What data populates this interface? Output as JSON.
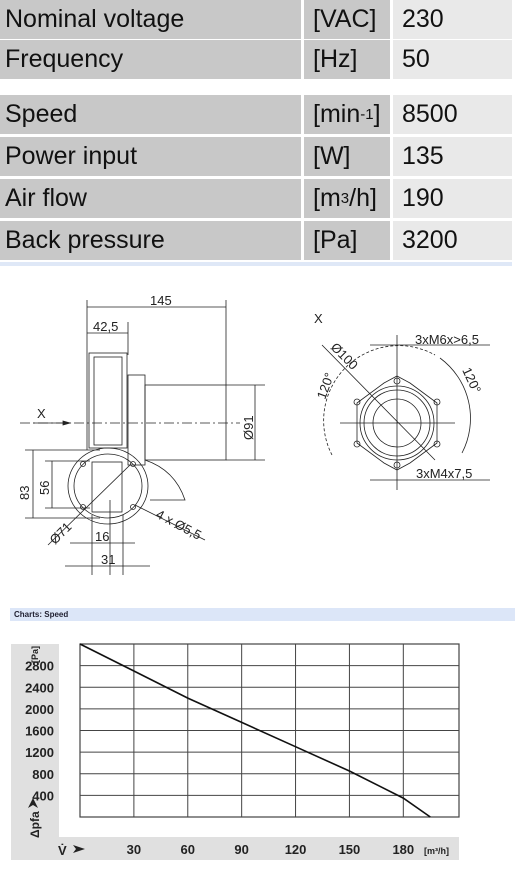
{
  "specs": [
    {
      "label": "Nominal voltage",
      "unit": "[VAC]",
      "value": "230"
    },
    {
      "label": "Frequency",
      "unit": "[Hz]",
      "value": "50"
    },
    {
      "label": "Speed",
      "unit": "[min-1]",
      "unit_base": "[min",
      "unit_sup": "-1",
      "unit_end": "]",
      "value": "8500"
    },
    {
      "label": "Power input",
      "unit": "[W]",
      "value": "135"
    },
    {
      "label": "Air flow",
      "unit": "[m3/h]",
      "unit_base": "[m",
      "unit_sup": "3",
      "unit_end": "/h]",
      "value": "190"
    },
    {
      "label": "Back pressure",
      "unit": "[Pa]",
      "value": "3200"
    }
  ],
  "drawing": {
    "dim_145": "145",
    "dim_42_5": "42,5",
    "axis_x": "X",
    "dim_91": "Ø91",
    "dim_83": "83",
    "dim_56": "56",
    "dim_71": "Ø71",
    "dim_16": "16",
    "dim_31": "31",
    "holes": "4 x Ø5,5",
    "view_x": "X",
    "dim_100": "Ø100",
    "thread_m6": "3xM6x>6,5",
    "thread_m4": "3xM4x7,5",
    "angle_left": "120°",
    "angle_right": "120°"
  },
  "chart_title": "Charts: Speed",
  "chart_data": {
    "type": "line",
    "ylabel": "Δpfa",
    "yunit": "[Pa]",
    "xlabel": "V̇",
    "xunit": "[m³/h]",
    "xlim": [
      0,
      211
    ],
    "ylim": [
      0,
      3200
    ],
    "xticks": [
      30,
      60,
      90,
      120,
      150,
      180
    ],
    "yticks": [
      400,
      800,
      1200,
      1600,
      2000,
      2400,
      2800
    ],
    "grid": true,
    "series": [
      {
        "color": "#111111",
        "points": [
          [
            0,
            3200
          ],
          [
            30,
            2700
          ],
          [
            60,
            2200
          ],
          [
            90,
            1750
          ],
          [
            120,
            1300
          ],
          [
            150,
            850
          ],
          [
            180,
            350
          ],
          [
            195,
            0
          ]
        ]
      }
    ]
  }
}
